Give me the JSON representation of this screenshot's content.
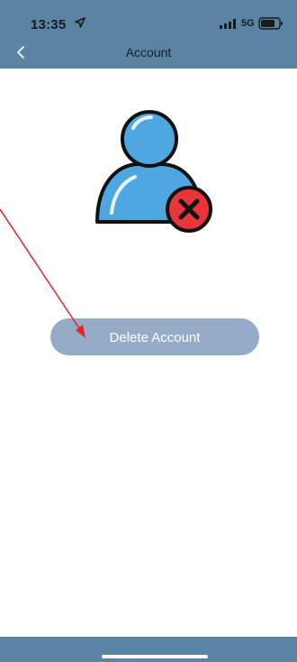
{
  "status_bar": {
    "time": "13:35",
    "network": "5G"
  },
  "header": {
    "title": "Account",
    "back_icon": "chevron-left-icon"
  },
  "avatar": {
    "icon": "user-remove-icon"
  },
  "actions": {
    "delete_label": "Delete Account"
  },
  "colors": {
    "header_bg": "#5b84a4",
    "button_bg": "#94acc8",
    "avatar_blue": "#4ea7e0",
    "badge_red": "#e8353a",
    "arrow_red": "#e52323"
  }
}
